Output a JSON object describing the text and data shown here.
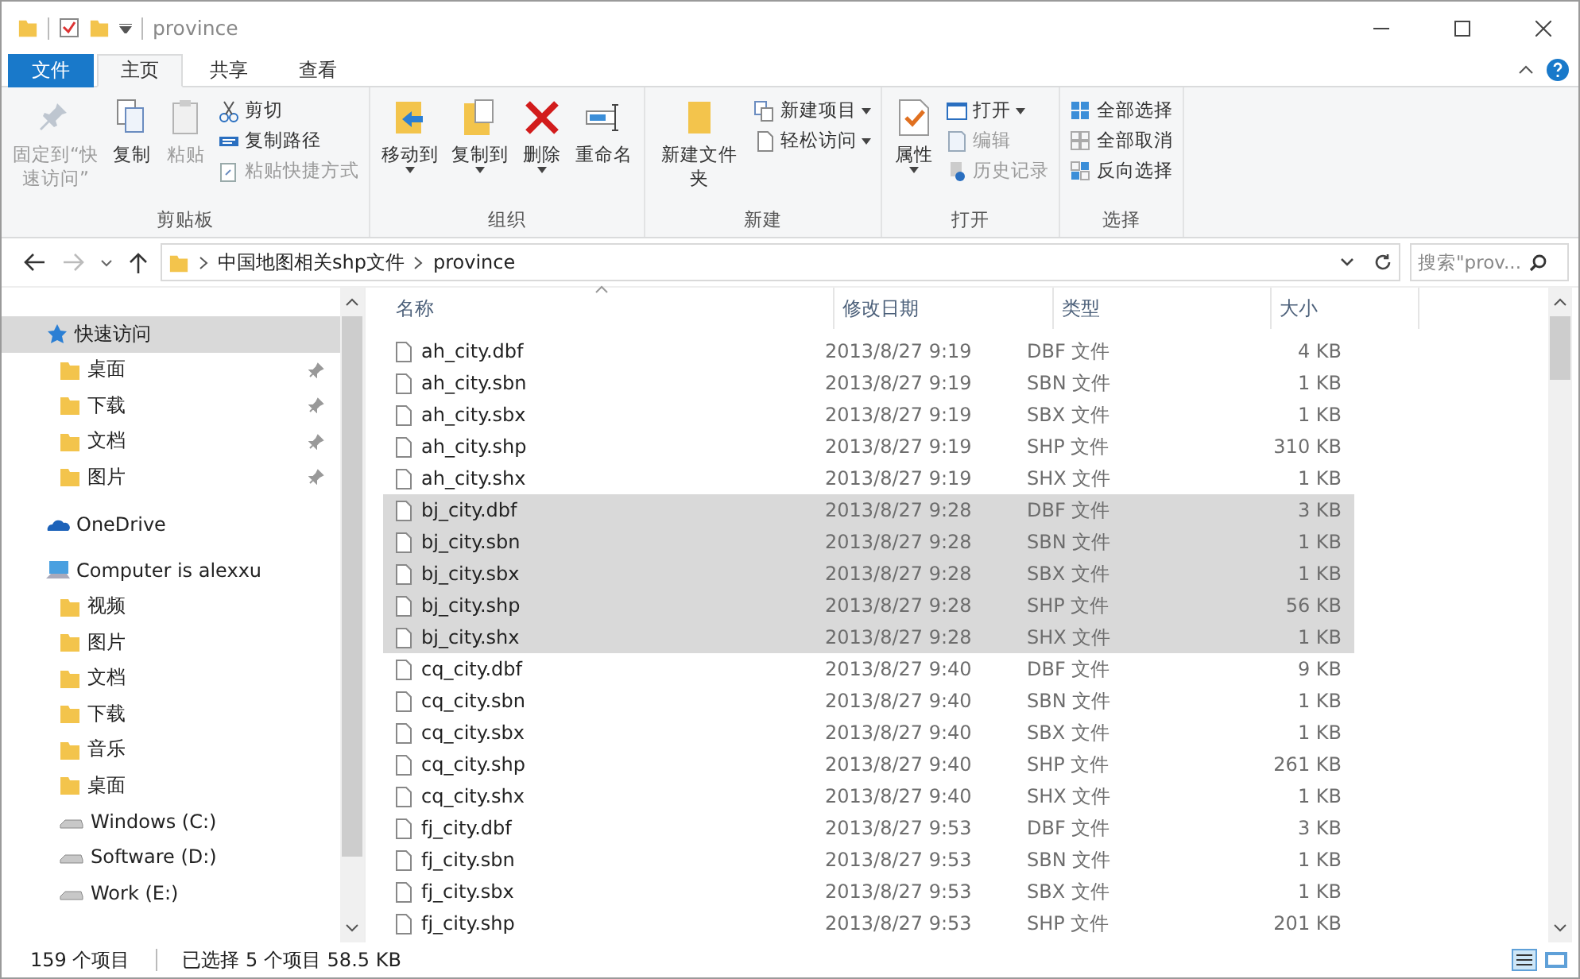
{
  "window": {
    "title": "province"
  },
  "tabs": [
    {
      "label": "文件",
      "kind": "file",
      "selected": false
    },
    {
      "label": "主页",
      "kind": "tab",
      "selected": true
    },
    {
      "label": "共享",
      "kind": "tab",
      "selected": false
    },
    {
      "label": "查看",
      "kind": "tab",
      "selected": false
    }
  ],
  "ribbon": {
    "groups": [
      {
        "label": "剪贴板",
        "buttons": [
          {
            "kind": "large",
            "label": "固定到“快速访问”",
            "disabled": true,
            "dropdown": false
          },
          {
            "kind": "large",
            "label": "复制",
            "disabled": false,
            "dropdown": false
          },
          {
            "kind": "large",
            "label": "粘贴",
            "disabled": true,
            "dropdown": false
          },
          {
            "kind": "small",
            "label": "剪切",
            "disabled": false,
            "dropdown": false
          },
          {
            "kind": "small",
            "label": "复制路径",
            "disabled": false,
            "dropdown": false
          },
          {
            "kind": "small",
            "label": "粘贴快捷方式",
            "disabled": true,
            "dropdown": false
          }
        ]
      },
      {
        "label": "组织",
        "buttons": [
          {
            "kind": "large",
            "label": "移动到",
            "disabled": false,
            "dropdown": true
          },
          {
            "kind": "large",
            "label": "复制到",
            "disabled": false,
            "dropdown": true
          },
          {
            "kind": "large",
            "label": "删除",
            "disabled": false,
            "dropdown": true
          },
          {
            "kind": "large",
            "label": "重命名",
            "disabled": false,
            "dropdown": false
          }
        ]
      },
      {
        "label": "新建",
        "buttons": [
          {
            "kind": "large",
            "label": "新建文件夹",
            "disabled": false,
            "dropdown": false
          },
          {
            "kind": "small",
            "label": "新建项目",
            "disabled": false,
            "dropdown": true
          },
          {
            "kind": "small",
            "label": "轻松访问",
            "disabled": false,
            "dropdown": true
          }
        ]
      },
      {
        "label": "打开",
        "buttons": [
          {
            "kind": "large",
            "label": "属性",
            "disabled": false,
            "dropdown": true
          },
          {
            "kind": "small",
            "label": "打开",
            "disabled": false,
            "dropdown": true
          },
          {
            "kind": "small",
            "label": "编辑",
            "disabled": true,
            "dropdown": false
          },
          {
            "kind": "small",
            "label": "历史记录",
            "disabled": true,
            "dropdown": false
          }
        ]
      },
      {
        "label": "选择",
        "buttons": [
          {
            "kind": "small",
            "label": "全部选择",
            "disabled": false,
            "dropdown": false
          },
          {
            "kind": "small",
            "label": "全部取消",
            "disabled": false,
            "dropdown": false
          },
          {
            "kind": "small",
            "label": "反向选择",
            "disabled": false,
            "dropdown": false
          }
        ]
      }
    ]
  },
  "address": {
    "path": [
      "中国地图相关shp文件",
      "province"
    ],
    "search": {
      "placeholder": "搜索\"prov..."
    }
  },
  "sidebar": {
    "items": [
      {
        "label": "快速访问",
        "selected": true,
        "children": [
          {
            "label": "桌面",
            "selected": false,
            "pinned": true
          },
          {
            "label": "下载",
            "selected": false,
            "pinned": true
          },
          {
            "label": "文档",
            "selected": false,
            "pinned": true
          },
          {
            "label": "图片",
            "selected": false,
            "pinned": true
          }
        ]
      },
      {
        "label": "OneDrive",
        "selected": false
      },
      {
        "label": "Computer is alexxu",
        "selected": false,
        "children": [
          {
            "label": "视频",
            "selected": false,
            "pinned": false
          },
          {
            "label": "图片",
            "selected": false,
            "pinned": false
          },
          {
            "label": "文档",
            "selected": false,
            "pinned": false
          },
          {
            "label": "下载",
            "selected": false,
            "pinned": false
          },
          {
            "label": "音乐",
            "selected": false,
            "pinned": false
          },
          {
            "label": "桌面",
            "selected": false,
            "pinned": false
          },
          {
            "label": "Windows (C:)",
            "selected": false,
            "pinned": false
          },
          {
            "label": "Software (D:)",
            "selected": false,
            "pinned": false
          },
          {
            "label": "Work (E:)",
            "selected": false,
            "pinned": false
          }
        ]
      }
    ]
  },
  "table": {
    "columns": [
      "名称",
      "修改日期",
      "类型",
      "大小"
    ],
    "rows": [
      {
        "name": "ah_city.dbf",
        "date": "2013/8/27 9:19",
        "type": "DBF 文件",
        "size": "4 KB",
        "selected": false
      },
      {
        "name": "ah_city.sbn",
        "date": "2013/8/27 9:19",
        "type": "SBN 文件",
        "size": "1 KB",
        "selected": false
      },
      {
        "name": "ah_city.sbx",
        "date": "2013/8/27 9:19",
        "type": "SBX 文件",
        "size": "1 KB",
        "selected": false
      },
      {
        "name": "ah_city.shp",
        "date": "2013/8/27 9:19",
        "type": "SHP 文件",
        "size": "310 KB",
        "selected": false
      },
      {
        "name": "ah_city.shx",
        "date": "2013/8/27 9:19",
        "type": "SHX 文件",
        "size": "1 KB",
        "selected": false
      },
      {
        "name": "bj_city.dbf",
        "date": "2013/8/27 9:28",
        "type": "DBF 文件",
        "size": "3 KB",
        "selected": true
      },
      {
        "name": "bj_city.sbn",
        "date": "2013/8/27 9:28",
        "type": "SBN 文件",
        "size": "1 KB",
        "selected": true
      },
      {
        "name": "bj_city.sbx",
        "date": "2013/8/27 9:28",
        "type": "SBX 文件",
        "size": "1 KB",
        "selected": true
      },
      {
        "name": "bj_city.shp",
        "date": "2013/8/27 9:28",
        "type": "SHP 文件",
        "size": "56 KB",
        "selected": true
      },
      {
        "name": "bj_city.shx",
        "date": "2013/8/27 9:28",
        "type": "SHX 文件",
        "size": "1 KB",
        "selected": true
      },
      {
        "name": "cq_city.dbf",
        "date": "2013/8/27 9:40",
        "type": "DBF 文件",
        "size": "9 KB",
        "selected": false
      },
      {
        "name": "cq_city.sbn",
        "date": "2013/8/27 9:40",
        "type": "SBN 文件",
        "size": "1 KB",
        "selected": false
      },
      {
        "name": "cq_city.sbx",
        "date": "2013/8/27 9:40",
        "type": "SBX 文件",
        "size": "1 KB",
        "selected": false
      },
      {
        "name": "cq_city.shp",
        "date": "2013/8/27 9:40",
        "type": "SHP 文件",
        "size": "261 KB",
        "selected": false
      },
      {
        "name": "cq_city.shx",
        "date": "2013/8/27 9:40",
        "type": "SHX 文件",
        "size": "1 KB",
        "selected": false
      },
      {
        "name": "fj_city.dbf",
        "date": "2013/8/27 9:53",
        "type": "DBF 文件",
        "size": "3 KB",
        "selected": false
      },
      {
        "name": "fj_city.sbn",
        "date": "2013/8/27 9:53",
        "type": "SBN 文件",
        "size": "1 KB",
        "selected": false
      },
      {
        "name": "fj_city.sbx",
        "date": "2013/8/27 9:53",
        "type": "SBX 文件",
        "size": "1 KB",
        "selected": false
      },
      {
        "name": "fj_city.shp",
        "date": "2013/8/27 9:53",
        "type": "SHP 文件",
        "size": "201 KB",
        "selected": false
      }
    ]
  },
  "status_bar": {
    "count": "159 个项目",
    "selection": "已选择 5 个项目  58.5 KB"
  }
}
